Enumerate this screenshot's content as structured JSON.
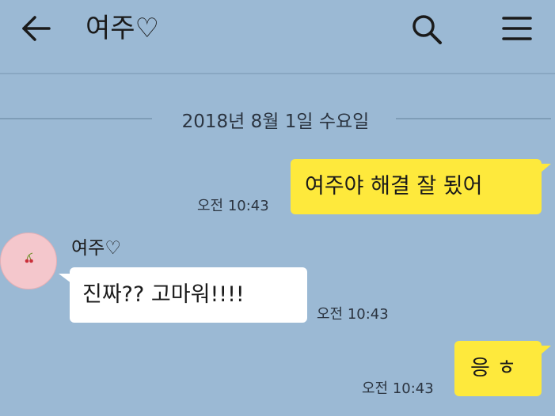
{
  "header": {
    "title": "여주♡",
    "back_icon": "arrow-left-icon",
    "search_icon": "search-icon",
    "menu_icon": "hamburger-menu-icon"
  },
  "date_divider": "2018년 8월 1일 수요일",
  "messages": [
    {
      "direction": "sent",
      "text": "여주야 해결 잘 됬어",
      "time": "오전 10:43"
    },
    {
      "direction": "received",
      "sender": "여주♡",
      "text": "진짜?? 고마워!!!!",
      "time": "오전 10:43"
    },
    {
      "direction": "sent",
      "text": "응 ㅎ",
      "time": "오전 10:43"
    }
  ],
  "colors": {
    "background": "#9bb9d4",
    "sent_bubble": "#fee93c",
    "received_bubble": "#ffffff",
    "avatar": "#f4c7cc",
    "avatar_icon": "cherry-icon"
  }
}
